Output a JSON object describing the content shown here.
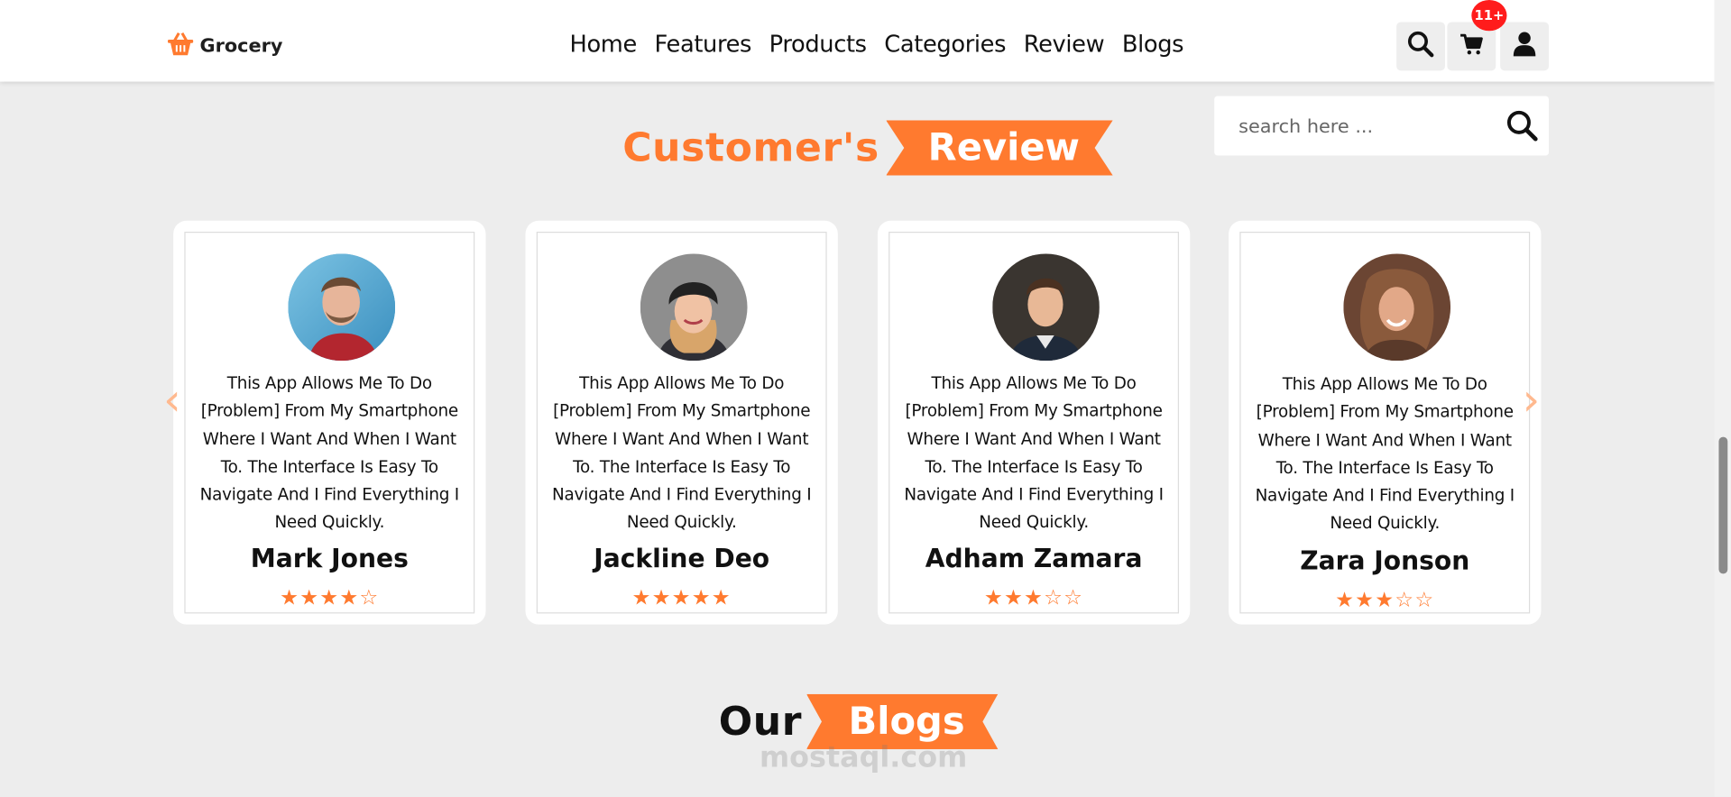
{
  "header": {
    "brand": "Grocery",
    "nav": [
      "Home",
      "Features",
      "Products",
      "Categories",
      "Review",
      "Blogs"
    ],
    "cart_badge": "11+"
  },
  "search": {
    "placeholder": "search here ..."
  },
  "review_section": {
    "title_plain": "Customer's",
    "title_ribbon": "Review",
    "prev_arrow": "‹",
    "next_arrow": "›",
    "reviews": [
      {
        "name": "Mark Jones",
        "text": "This App Allows Me To Do [Problem] From My Smartphone Where I Want And When I Want To. The Interface Is Easy To Navigate And I Find Everything I Need Quickly.",
        "rating": 4,
        "stars": "★★★★☆"
      },
      {
        "name": "Jackline Deo",
        "text": "This App Allows Me To Do [Problem] From My Smartphone Where I Want And When I Want To. The Interface Is Easy To Navigate And I Find Everything I Need Quickly.",
        "rating": 5,
        "stars": "★★★★★"
      },
      {
        "name": "Adham Zamara",
        "text": "This App Allows Me To Do [Problem] From My Smartphone Where I Want And When I Want To. The Interface Is Easy To Navigate And I Find Everything I Need Quickly.",
        "rating": 3,
        "stars": "★★★☆☆"
      },
      {
        "name": "Zara Jonson",
        "text": "This App Allows Me To Do [Problem] From My Smartphone Where I Want And When I Want To. The Interface Is Easy To Navigate And I Find Everything I Need Quickly.",
        "rating": 3,
        "stars": "★★★☆☆"
      }
    ]
  },
  "blogs_section": {
    "title_plain": "Our",
    "title_ribbon": "Blogs"
  },
  "watermark": "mostaql.com",
  "colors": {
    "accent": "#ff7a2f",
    "badge": "#ff1c1c",
    "background": "#ededed"
  }
}
